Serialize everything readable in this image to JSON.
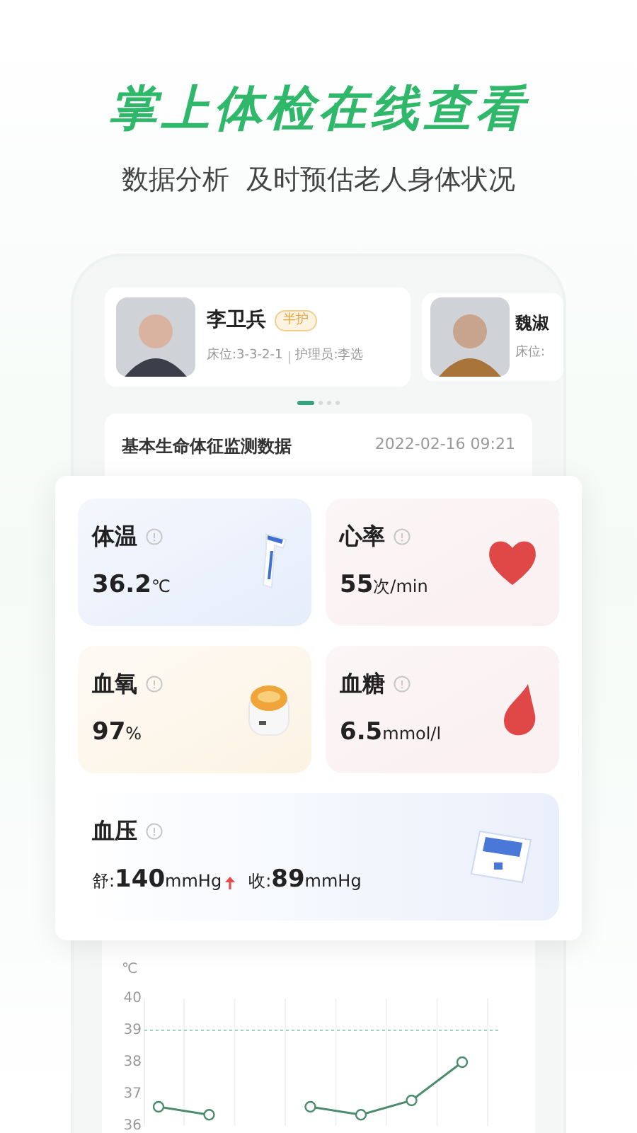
{
  "headline": "掌上体检在线查看",
  "subtitle": "数据分析  及时预估老人身体状况",
  "residents": [
    {
      "name": "李卫兵",
      "tag": "半护",
      "bed": "床位:3-3-2-1",
      "nurse": "护理员:李选"
    },
    {
      "name": "魏淑",
      "bed": "床位:"
    }
  ],
  "pager": [
    {
      "selected": true
    },
    {
      "selected": false
    },
    {
      "selected": false
    },
    {
      "selected": false
    }
  ],
  "section": {
    "title": "基本生命体征监测数据",
    "time": "2022-02-16 09:21"
  },
  "vitals": [
    {
      "kind": "temperature",
      "label": "体温",
      "value": "36.2",
      "unit": "℃"
    },
    {
      "kind": "heart",
      "label": "心率",
      "value": "55",
      "unit": "次/min"
    },
    {
      "kind": "oxygen",
      "label": "血氧",
      "value": "97",
      "unit": "%"
    },
    {
      "kind": "glucose",
      "label": "血糖",
      "value": "6.5",
      "unit": "mmol/l"
    }
  ],
  "blood_pressure": {
    "label": "血压",
    "readings": [
      {
        "label": "舒:",
        "value": "140",
        "unit": "mmHg",
        "up": true
      },
      {
        "label": "收:",
        "value": "89",
        "unit": "mmHg",
        "up": false
      }
    ]
  },
  "chart_data": {
    "type": "line",
    "ylabel": "℃",
    "yticks": [
      36,
      37,
      38,
      39,
      40
    ],
    "ylim": [
      36,
      40
    ],
    "series": [
      {
        "color": "#4a8c6c",
        "marker": "o",
        "values": [
          36.6,
          36.35,
          null,
          36.6,
          36.35,
          36.8,
          38.0
        ]
      }
    ],
    "ref_lines": [
      {
        "axis": "y",
        "value": 39
      }
    ]
  }
}
